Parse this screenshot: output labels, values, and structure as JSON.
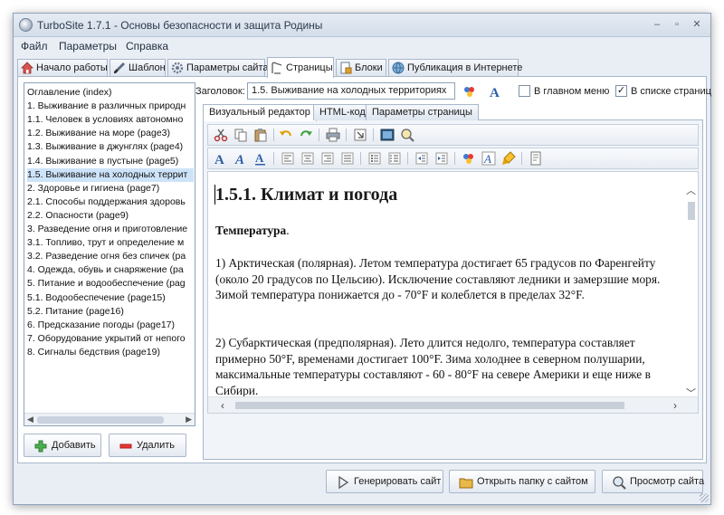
{
  "window": {
    "title": "TurboSite 1.7.1 - Основы безопасности и защита Родины",
    "controls": {
      "minimize": "‒",
      "maximize": "▫",
      "close": "✕"
    }
  },
  "menu": [
    "Файл",
    "Параметры",
    "Справка"
  ],
  "tabs": [
    {
      "label": "Начало работы",
      "icon": "home-icon"
    },
    {
      "label": "Шаблон",
      "icon": "brush-icon"
    },
    {
      "label": "Параметры сайта",
      "icon": "gear-icon"
    },
    {
      "label": "Страницы",
      "icon": "pages-icon",
      "active": true
    },
    {
      "label": "Блоки",
      "icon": "blocks-icon"
    },
    {
      "label": "Публикация в Интернете",
      "icon": "globe-icon"
    }
  ],
  "tree": {
    "items": [
      "Оглавление (index)",
      "1. Выживание в различных природн",
      "1.1. Человек в условиях автономно",
      "1.2. Выживание на море (page3)",
      "1.3. Выживание в джунглях (page4)",
      "1.4. Выживание в пустыне (page5)",
      "1.5. Выживание на холодных террит",
      "2. Здоровье и гигиена (page7)",
      "2.1. Способы поддержания здоровь",
      "2.2. Опасности (page9)",
      "3. Разведение огня и приготовление",
      "3.1. Топливо, трут и определение м",
      "3.2. Разведение огня без спичек (pa",
      "4. Одежда, обувь и снаряжение (pa",
      "5. Питание и водообеспечение (pag",
      "5.1. Водообеспечение (page15)",
      "5.2. Питание (page16)",
      "6. Предсказание погоды (page17)",
      "7. Оборудование укрытий от непого",
      "8. Сигналы бедствия (page19)"
    ],
    "selected_index": 6
  },
  "left_buttons": {
    "add": "Добавить",
    "remove": "Удалить"
  },
  "page_header": {
    "title_label": "Заголовок:",
    "title_value": "1.5. Выживание на холодных территориях",
    "in_main_menu": "В главном меню",
    "in_main_menu_checked": false,
    "in_pages_list": "В списке страниц",
    "in_pages_list_checked": true
  },
  "editor_tabs": [
    "Визуальный редактор",
    "HTML-код",
    "Параметры страницы"
  ],
  "document": {
    "heading": "1.5.1. Климат и погода",
    "subheading": "Температура",
    "subheading_tail": ".",
    "para1": "1) Арктическая (полярная). Летом температура достигает 65 градусов по Фаренгейту (около 20 градусов по Цельсию). Исключение составляют ледники и замерзшие моря. Зимой температура понижается до - 70°F и колеблется в пределах 32°F.",
    "para2": " 2) Субарктическая (предполярная). Лето длится недолго, температура составляет примерно 50°F, временами достигает 100°F. Зима холоднее в северном полушарии, максимальные температуры составляют - 60 - 80°F на севере Америки и еще ниже в Сибири."
  },
  "bottom_buttons": {
    "generate": "Генерировать сайт",
    "open_folder": "Открыть папку с сайтом",
    "preview": "Просмотр сайта"
  },
  "colors": {
    "accent": "#cde3f9",
    "window_bg": "#e9eef5",
    "border": "#8ea2bb"
  }
}
